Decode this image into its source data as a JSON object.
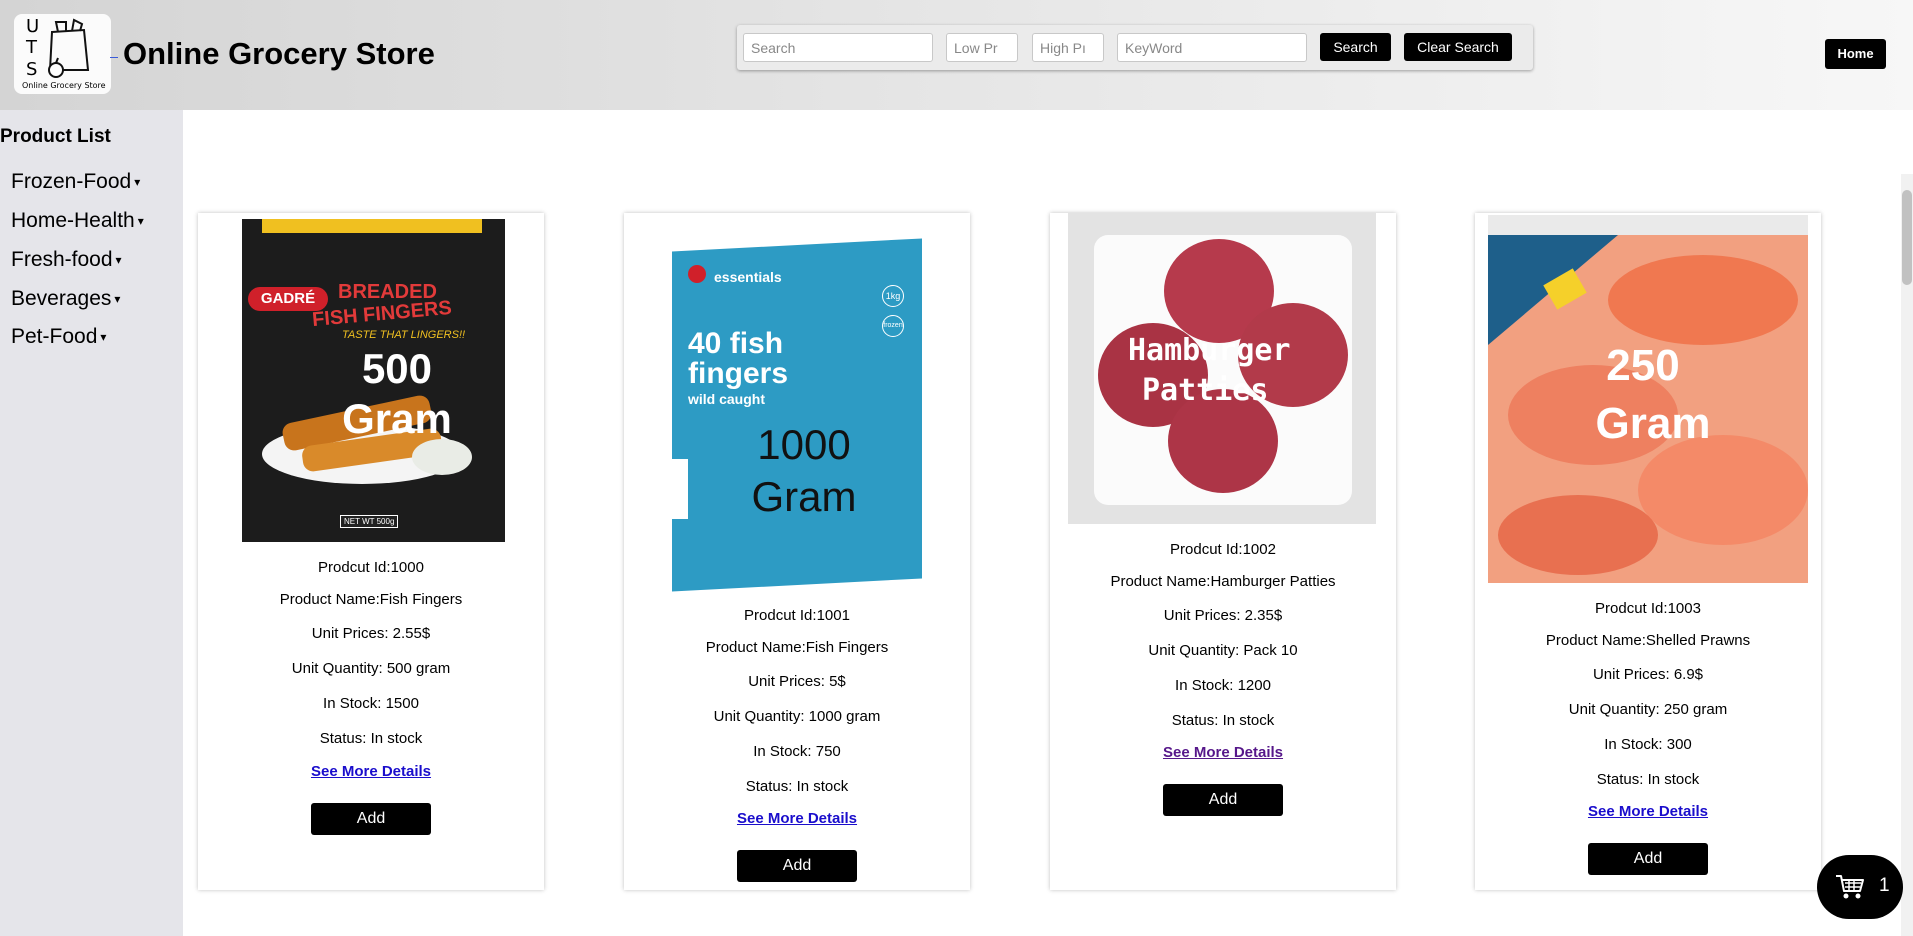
{
  "header": {
    "logo_letters": [
      "U",
      "T",
      "S"
    ],
    "logo_subtitle": "Online Grocery Store",
    "title": "Online Grocery Store",
    "search": {
      "search_placeholder": "Search",
      "low_price_placeholder": "Low Pr",
      "high_price_placeholder": "High Pı",
      "keyword_placeholder": "KeyWord",
      "search_button": "Search",
      "clear_button": "Clear Search"
    },
    "home_button": "Home"
  },
  "sidebar": {
    "title": "Product List",
    "categories": [
      {
        "label": "Frozen-Food",
        "caret": "▾"
      },
      {
        "label": "Home-Health",
        "caret": "▾"
      },
      {
        "label": "Fresh-food",
        "caret": "▾"
      },
      {
        "label": "Beverages",
        "caret": "▾"
      },
      {
        "label": "Pet-Food",
        "caret": "▾"
      }
    ]
  },
  "products": [
    {
      "id_line": "Prodcut Id:1000",
      "name_line": "Product Name:Fish Fingers",
      "price_line": "Unit Prices:  2.55$",
      "qty_line": "Unit Quantity:  500 gram",
      "stock_line": "In Stock:  1500",
      "status_line": "Status:  In stock",
      "details_link": "See More Details",
      "add_button": "Add",
      "image_overlay": [
        "500",
        "Gram"
      ],
      "package_brand": "GADRÉ",
      "package_text": [
        "BREADED",
        "FISH FINGERS",
        "TASTE THAT LINGERS!!"
      ],
      "package_weight": "NET WT 500g"
    },
    {
      "id_line": "Prodcut Id:1001",
      "name_line": "Product Name:Fish Fingers",
      "price_line": "Unit Prices:  5$",
      "qty_line": "Unit Quantity:  1000 gram",
      "stock_line": "In Stock:  750",
      "status_line": "Status:  In stock",
      "details_link": "See More Details",
      "add_button": "Add",
      "image_overlay": [
        "1000",
        "Gram"
      ],
      "package_brand": "essentials",
      "package_text": [
        "40 fish",
        "fingers",
        "wild caught"
      ],
      "package_badges": [
        "1kg",
        "frozen"
      ]
    },
    {
      "id_line": "Prodcut Id:1002",
      "name_line": "Product Name:Hamburger Patties",
      "price_line": "Unit Prices:  2.35$",
      "qty_line": "Unit Quantity:  Pack 10",
      "stock_line": "In Stock:  1200",
      "status_line": "Status:  In stock",
      "details_link": "See More Details",
      "add_button": "Add",
      "image_overlay": [
        "Hamburger",
        "Patties"
      ]
    },
    {
      "id_line": "Prodcut Id:1003",
      "name_line": "Product Name:Shelled Prawns",
      "price_line": "Unit Prices:  6.9$",
      "qty_line": "Unit Quantity:  250 gram",
      "stock_line": "In Stock:  300",
      "status_line": "Status:  In stock",
      "details_link": "See More Details",
      "add_button": "Add",
      "image_overlay": [
        "250",
        "Gram"
      ]
    }
  ],
  "cart": {
    "icon": "cart-icon",
    "count": "1"
  }
}
